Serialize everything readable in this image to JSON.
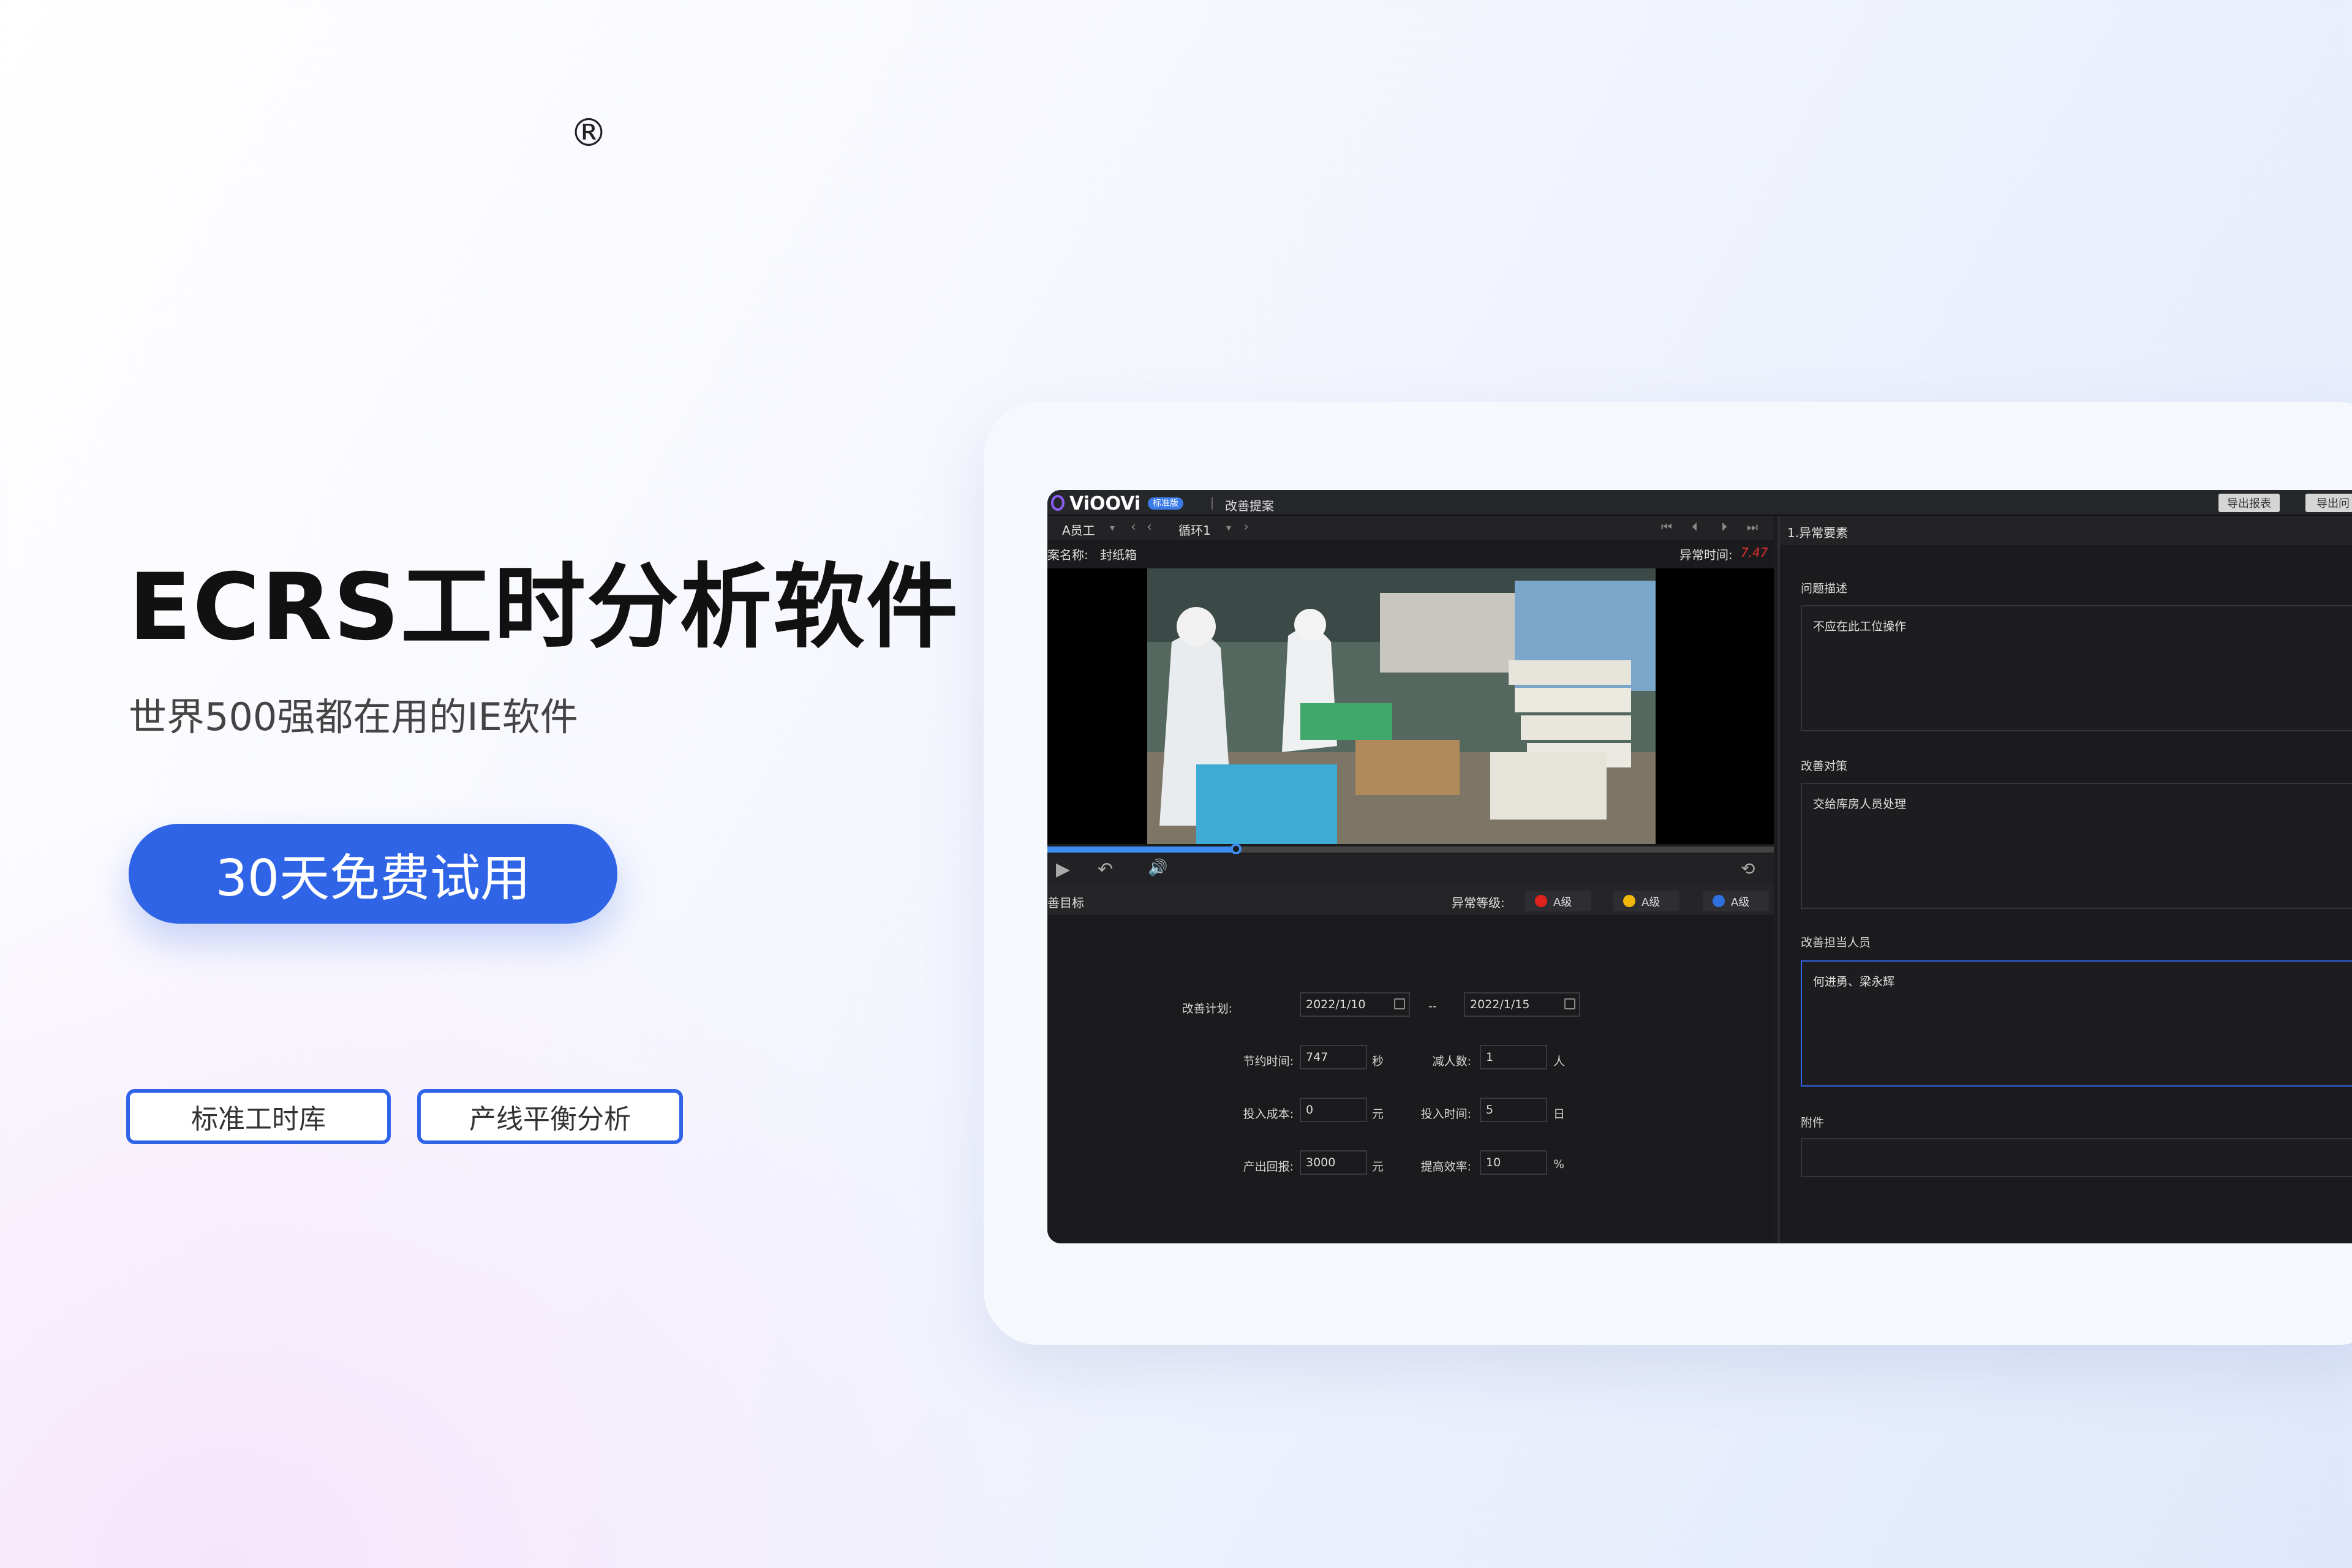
{
  "hero": {
    "reg_mark": "®",
    "title": "ECRS工时分析软件",
    "subtitle": "世界500强都在用的IE软件",
    "cta_label": "30天免费试用",
    "tags": [
      "标准工时库",
      "产线平衡分析"
    ]
  },
  "app": {
    "brand": "ViOOVi",
    "badge": "标准版",
    "window_title": "改善提案",
    "export_buttons": [
      "导出报表",
      "导出问"
    ],
    "toolbar": {
      "employee": "A员工",
      "cycle": "循环1",
      "right_title": "1.异常要素"
    },
    "info": {
      "case_label": "案名称:",
      "case_value": "封纸箱",
      "abnormal_time_label": "异常时间:",
      "abnormal_time_value": "7.47"
    },
    "video": {
      "progress_fraction": 0.26
    },
    "target": {
      "label": "善目标",
      "level_label": "异常等级:",
      "levels": [
        {
          "name": "A级",
          "color": "#e0221d"
        },
        {
          "name": "A级",
          "color": "#f0b80c"
        },
        {
          "name": "A级",
          "color": "#2f6fe0"
        }
      ]
    },
    "form": {
      "plan_label": "改善计划:",
      "plan_start": "2022/1/10",
      "plan_sep": "--",
      "plan_end": "2022/1/15",
      "save_time_label": "节约时间:",
      "save_time_value": "747",
      "save_time_unit": "秒",
      "reduce_people_label": "减人数:",
      "reduce_people_value": "1",
      "reduce_people_unit": "人",
      "cost_label": "投入成本:",
      "cost_value": "0",
      "cost_unit": "元",
      "invest_time_label": "投入时间:",
      "invest_time_value": "5",
      "invest_time_unit": "日",
      "return_label": "产出回报:",
      "return_value": "3000",
      "return_unit": "元",
      "efficiency_label": "提高效率:",
      "efficiency_value": "10",
      "efficiency_unit": "%"
    },
    "right": {
      "problem_label": "问题描述",
      "problem_value": "不应在此工位操作",
      "measure_label": "改善对策",
      "measure_value": "交给库房人员处理",
      "owner_label": "改善担当人员",
      "owner_value": "何进勇、梁永辉",
      "attachment_label": "附件"
    }
  }
}
